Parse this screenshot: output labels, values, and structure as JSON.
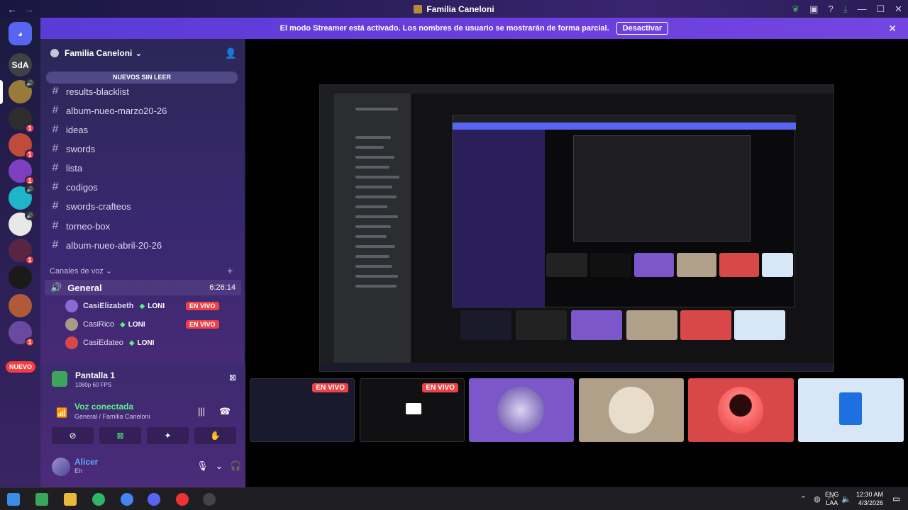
{
  "window": {
    "title": "Familia Caneloni"
  },
  "banner": {
    "text": "El modo Streamer está activado. Los nombres de usuario se mostrarán de forma parcial.",
    "button": "Desactivar"
  },
  "servers": {
    "home_label": "SdA",
    "nuevo": "NUEVO",
    "badges": [
      "1",
      "1",
      "1",
      "1",
      "1"
    ]
  },
  "sidebar": {
    "guild_name": "Familia Caneloni",
    "unread_bar": "NUEVOS SIN LEER",
    "channels": [
      "results-blacklist",
      "album-nueo-marzo20-26",
      "ideas",
      "swords",
      "lista",
      "codigos",
      "swords-crafteos",
      "torneo-box",
      "album-nueo-abril-20-26"
    ],
    "voice_category": "Canales de voz",
    "voice_channel": {
      "name": "General",
      "time": "6:26:14"
    },
    "voice_users": [
      {
        "name": "CasiElizabeth",
        "tag": "LONI",
        "live": "EN VIVO"
      },
      {
        "name": "CasiRico",
        "tag": "LONI",
        "live": "EN VIVO"
      },
      {
        "name": "CasiEdateo",
        "tag": "LONI",
        "live": ""
      }
    ]
  },
  "panel": {
    "stream_name": "Pantalla 1",
    "stream_quality": "1080p 60 FPS",
    "voice_status": "Voz conectada",
    "voice_location": "General / Familia Caneloni",
    "user_name": "Alicer",
    "user_status": "Eh"
  },
  "stage": {
    "tiles": [
      {
        "live": "EN VIVO",
        "color": "#1a1a2e"
      },
      {
        "live": "EN VIVO",
        "color": "#111114"
      },
      {
        "live": "",
        "color": "#7b57c9"
      },
      {
        "live": "",
        "color": "#b0a089"
      },
      {
        "live": "",
        "color": "#d94848"
      },
      {
        "live": "",
        "color": "#d7e7f7"
      }
    ]
  },
  "taskbar": {
    "lang1": "ENG",
    "lang2": "LAA",
    "time": "12:30 AM",
    "date": "4/3/2026"
  },
  "colors": {
    "blurple": "#5865f2",
    "green": "#3ba55c",
    "red": "#ed4245",
    "streamer": "#6a3ddd"
  }
}
